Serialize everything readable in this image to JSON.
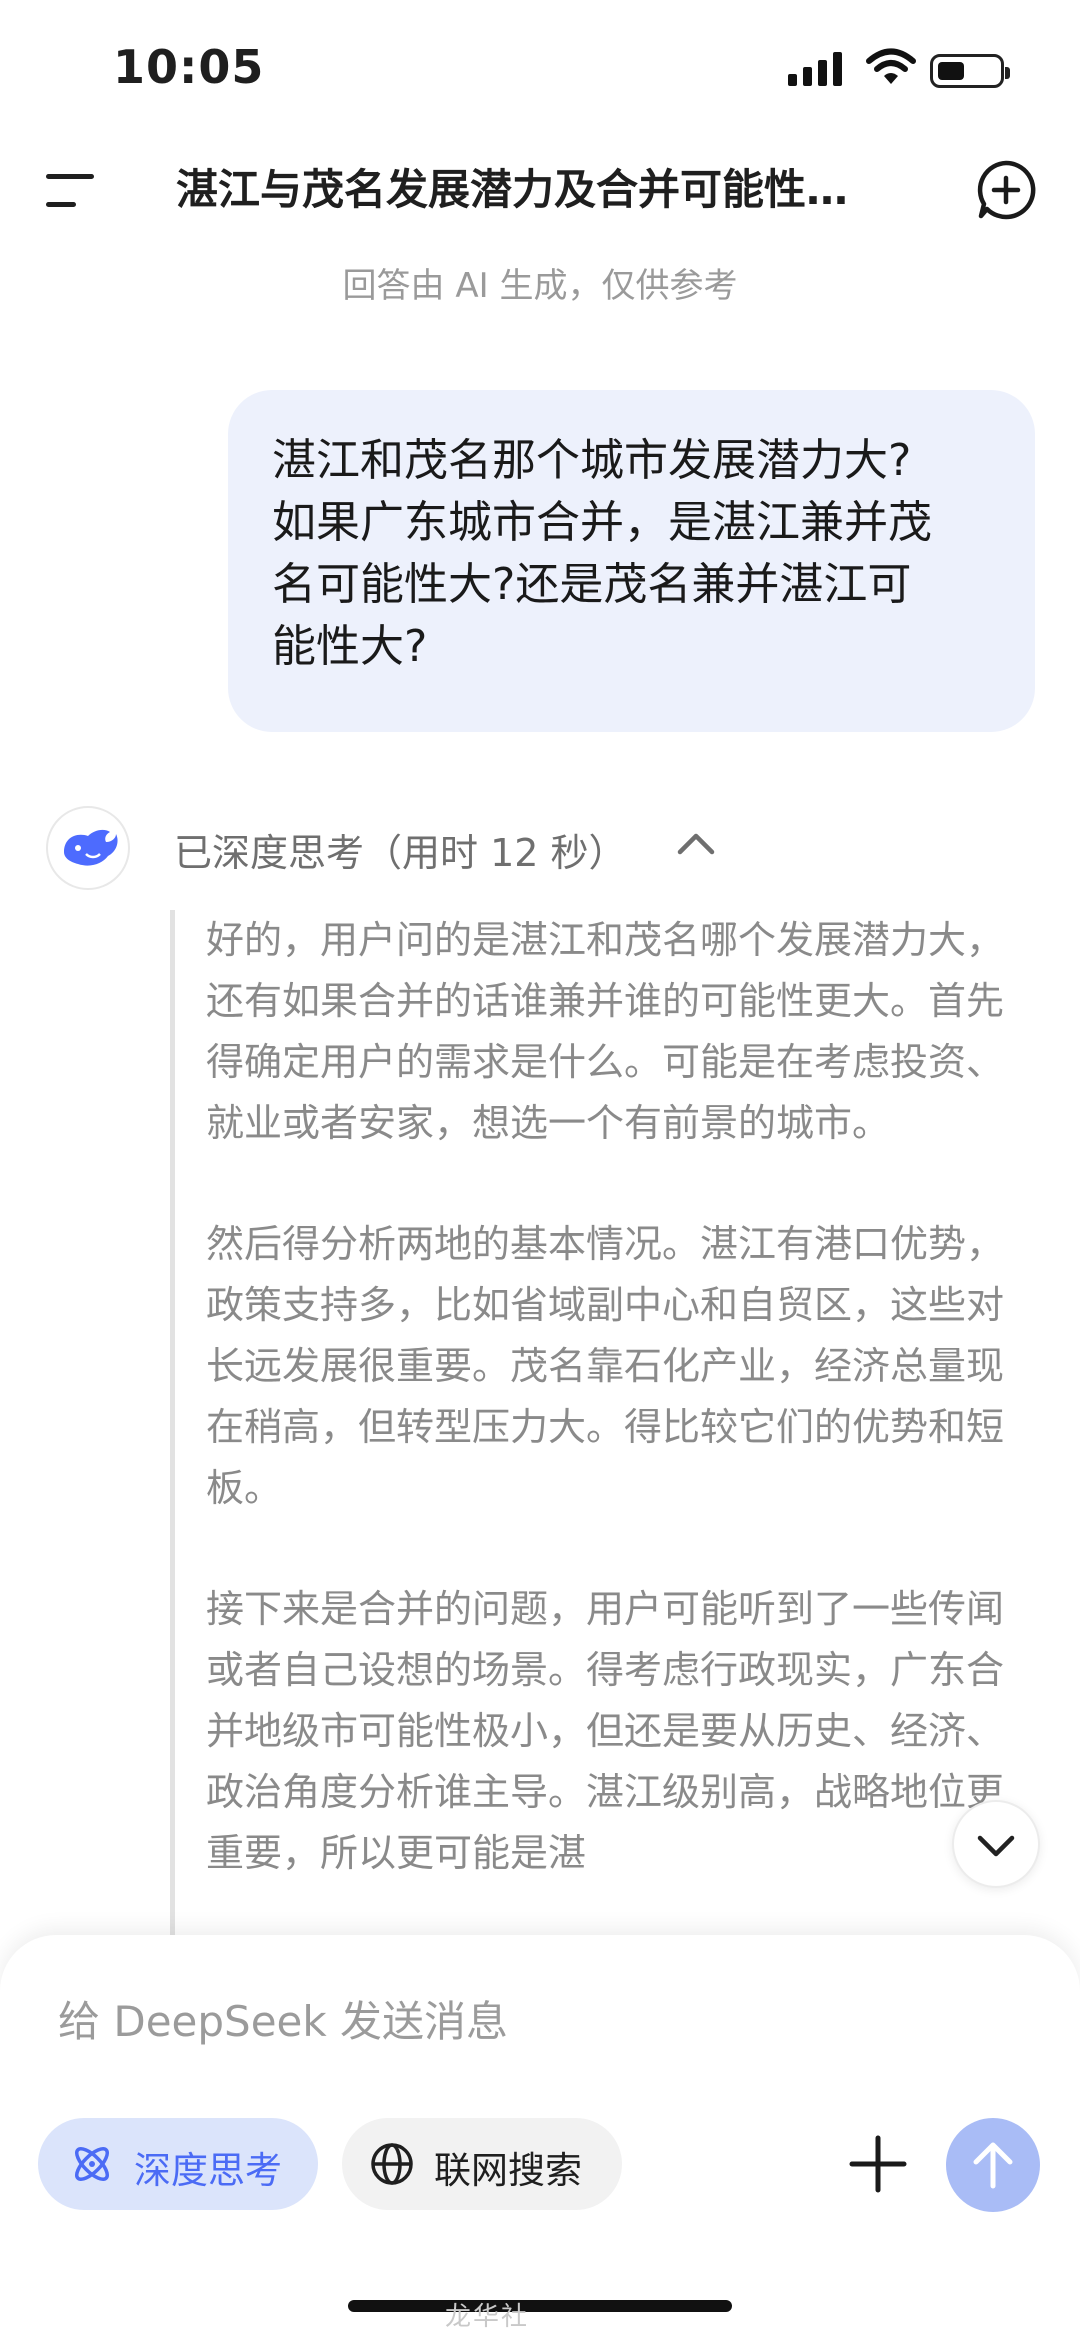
{
  "status_bar": {
    "time": "10:05"
  },
  "header": {
    "title": "湛江与茂名发展潜力及合并可能性…",
    "disclaimer": "回答由 AI 生成，仅供参考"
  },
  "user_message": {
    "lines": [
      "湛江和茂名那个城市发展潜力大?",
      "如果广东城市合并，是湛江兼并茂",
      "名可能性大?还是茂名兼并湛江可",
      "能性大?"
    ]
  },
  "thinking": {
    "label": "已深度思考（用时 12 秒）",
    "paragraphs": [
      "好的，用户问的是湛江和茂名哪个发展潜力大，还有如果合并的话谁兼并谁的可能性更大。首先得确定用户的需求是什么。可能是在考虑投资、就业或者安家，想选一个有前景的城市。",
      "然后得分析两地的基本情况。湛江有港口优势，政策支持多，比如省域副中心和自贸区，这些对长远发展很重要。茂名靠石化产业，经济总量现在稍高，但转型压力大。得比较它们的优势和短板。",
      "接下来是合并的问题，用户可能听到了一些传闻或者自己设想的场景。得考虑行政现实，广东合并地级市可能性极小，但还是要从历史、经济、政治角度分析谁主导。湛江级别高，战略地位更重要，所以更可能是湛"
    ]
  },
  "composer": {
    "placeholder": "给 DeepSeek 发送消息",
    "deep_think_label": "深度思考",
    "web_search_label": "联网搜索"
  },
  "watermark": "龙华社"
}
